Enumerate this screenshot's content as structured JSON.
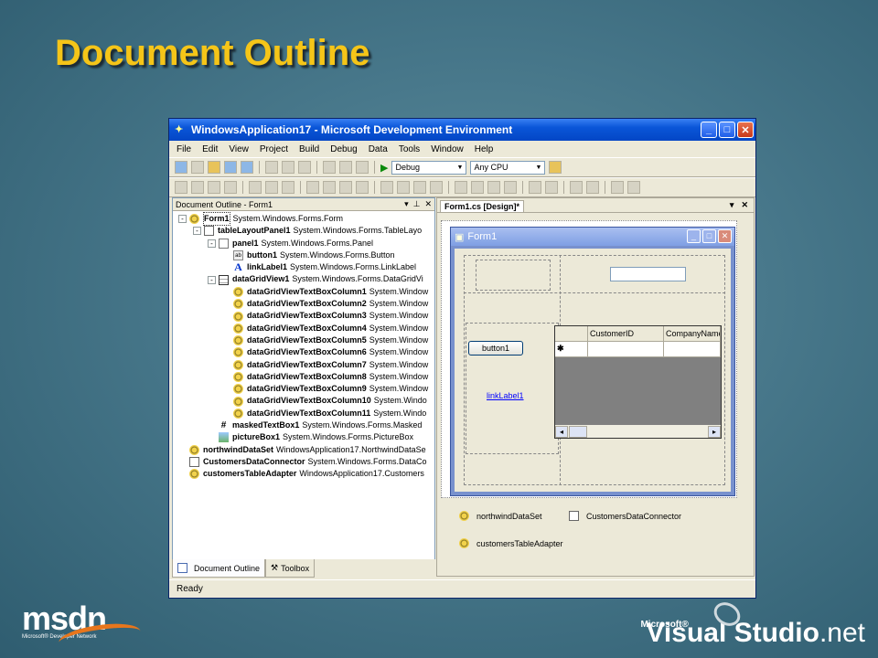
{
  "slide": {
    "title": "Document Outline"
  },
  "window": {
    "title": "WindowsApplication17 - Microsoft Development Environment",
    "menu": [
      "File",
      "Edit",
      "View",
      "Project",
      "Build",
      "Debug",
      "Data",
      "Tools",
      "Window",
      "Help"
    ],
    "toolbar": {
      "config": "Debug",
      "platform": "Any CPU"
    },
    "status": "Ready"
  },
  "outline": {
    "title": "Document Outline - Form1",
    "items": [
      {
        "name": "Form1",
        "type": "System.Windows.Forms.Form",
        "indent": 0,
        "icon": "gear",
        "exp": "-",
        "sel": true
      },
      {
        "name": "tableLayoutPanel1",
        "type": "System.Windows.Forms.TableLayo",
        "indent": 1,
        "icon": "tbl",
        "exp": "-"
      },
      {
        "name": "panel1",
        "type": "System.Windows.Forms.Panel",
        "indent": 2,
        "icon": "panel",
        "exp": "-"
      },
      {
        "name": "button1",
        "type": "System.Windows.Forms.Button",
        "indent": 3,
        "icon": "btn"
      },
      {
        "name": "linkLabel1",
        "type": "System.Windows.Forms.LinkLabel",
        "indent": 3,
        "icon": "link"
      },
      {
        "name": "dataGridView1",
        "type": "System.Windows.Forms.DataGridVi",
        "indent": 2,
        "icon": "grid",
        "exp": "-"
      },
      {
        "name": "dataGridViewTextBoxColumn1",
        "type": "System.Window",
        "indent": 3,
        "icon": "gear"
      },
      {
        "name": "dataGridViewTextBoxColumn2",
        "type": "System.Window",
        "indent": 3,
        "icon": "gear"
      },
      {
        "name": "dataGridViewTextBoxColumn3",
        "type": "System.Window",
        "indent": 3,
        "icon": "gear"
      },
      {
        "name": "dataGridViewTextBoxColumn4",
        "type": "System.Window",
        "indent": 3,
        "icon": "gear"
      },
      {
        "name": "dataGridViewTextBoxColumn5",
        "type": "System.Window",
        "indent": 3,
        "icon": "gear"
      },
      {
        "name": "dataGridViewTextBoxColumn6",
        "type": "System.Window",
        "indent": 3,
        "icon": "gear"
      },
      {
        "name": "dataGridViewTextBoxColumn7",
        "type": "System.Window",
        "indent": 3,
        "icon": "gear"
      },
      {
        "name": "dataGridViewTextBoxColumn8",
        "type": "System.Window",
        "indent": 3,
        "icon": "gear"
      },
      {
        "name": "dataGridViewTextBoxColumn9",
        "type": "System.Window",
        "indent": 3,
        "icon": "gear"
      },
      {
        "name": "dataGridViewTextBoxColumn10",
        "type": "System.Windo",
        "indent": 3,
        "icon": "gear"
      },
      {
        "name": "dataGridViewTextBoxColumn11",
        "type": "System.Windo",
        "indent": 3,
        "icon": "gear"
      },
      {
        "name": "maskedTextBox1",
        "type": "System.Windows.Forms.Masked",
        "indent": 2,
        "icon": "mask"
      },
      {
        "name": "pictureBox1",
        "type": "System.Windows.Forms.PictureBox",
        "indent": 2,
        "icon": "pic"
      },
      {
        "name": "northwindDataSet",
        "type": "WindowsApplication17.NorthwindDataSe",
        "indent": 0,
        "icon": "gear"
      },
      {
        "name": "CustomersDataConnector",
        "type": "System.Windows.Forms.DataCo",
        "indent": 0,
        "icon": "tbl"
      },
      {
        "name": "customersTableAdapter",
        "type": "WindowsApplication17.Customers",
        "indent": 0,
        "icon": "gear"
      }
    ],
    "tabs": [
      "Document Outline",
      "Toolbox"
    ]
  },
  "designer": {
    "tab": "Form1.cs [Design]*",
    "form_title": "Form1",
    "button": "button1",
    "link": "linkLabel1",
    "grid_columns": [
      "CustomerID",
      "CompanyName"
    ],
    "new_row_marker": "✱",
    "tray": [
      "northwindDataSet",
      "CustomersDataConnector",
      "customersTableAdapter"
    ]
  },
  "logos": {
    "msdn": "msdn",
    "msdn_sub": "Microsoft® Developer Network",
    "vs_ms": "Microsoft®",
    "vs_a": "Visual Studio",
    "vs_b": ".net"
  }
}
